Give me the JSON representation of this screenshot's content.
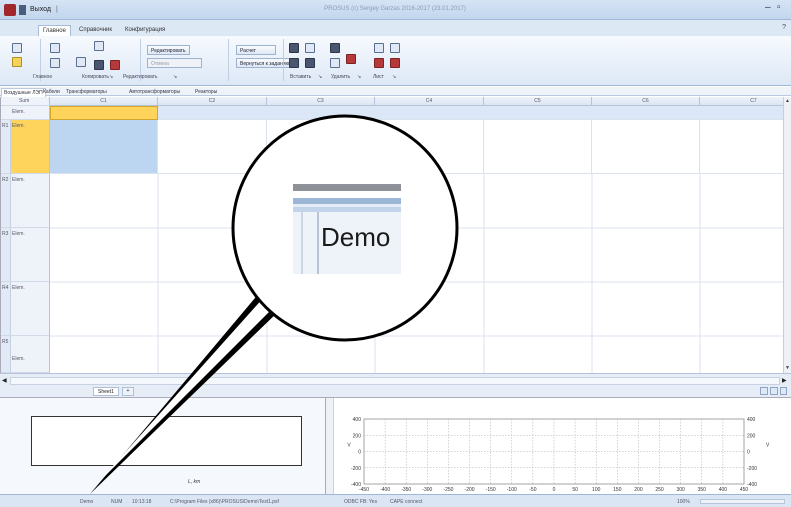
{
  "window": {
    "quick_access_label": "Выход",
    "quick_access_sep": "|",
    "title": "PROSUS (c) Sergey Garzas 2016-2017 (23.01.2017)",
    "minimize": "–",
    "restore": "▫",
    "help": "?"
  },
  "ribbon": {
    "tabs": [
      "Главное",
      "Справочник",
      "Конфигурация"
    ],
    "groups": [
      "Главное",
      "Копировать",
      "Редактировать",
      "Вставить",
      "Удалить",
      "Лист"
    ],
    "group_launcher": "↘",
    "buttons": {
      "edit": "Редактировать",
      "cancel": "Отмена",
      "calc": "Расчет",
      "return_to_task": "Вернуться к заданию"
    }
  },
  "doc_tabs": [
    "Воздушные ЛЭП",
    "Кабели",
    "Трансформаторы",
    "Автотрансформаторы",
    "Реакторы"
  ],
  "grid": {
    "corner_top": "Sum",
    "corner_elem": "Elem.",
    "columns": [
      "C1",
      "C2",
      "C3",
      "C4",
      "C5",
      "C6",
      "C7"
    ],
    "rows": [
      {
        "num": "R1",
        "elem": "Elem."
      },
      {
        "num": "R2",
        "elem": "Elem."
      },
      {
        "num": "R3",
        "elem": "Elem."
      },
      {
        "num": "R4",
        "elem": "Elem."
      },
      {
        "num": "R5",
        "elem": "Elem."
      }
    ]
  },
  "sheet_tab": "Sheet1",
  "sheet_add": "+",
  "cross_section": {
    "x_label": "L, km"
  },
  "chart_data": {
    "type": "line",
    "title": "",
    "xlabel": "",
    "ylabel": "V",
    "x_ticks": [
      -450,
      -400,
      -350,
      -300,
      -250,
      -200,
      -150,
      -100,
      -50,
      0,
      50,
      100,
      150,
      200,
      250,
      300,
      350,
      400,
      450
    ],
    "y_ticks": [
      400,
      200,
      0,
      -200,
      -400
    ],
    "y_right_ticks": [
      400,
      200,
      0,
      -200,
      -400
    ],
    "right_label": "V",
    "xlim": [
      -450,
      450
    ],
    "ylim": [
      -400,
      400
    ],
    "grid": true,
    "series": []
  },
  "statusbar": {
    "caps": "Demo",
    "num": "NUM",
    "time": "10:13:18",
    "path": "C:\\Program Files (x86)\\PROSUS\\Demo\\Test1.psf",
    "odbc": "ODBC FB: Yes",
    "cape": "CAPE connect",
    "zoom": "100%"
  },
  "magnifier": {
    "text": "Demo"
  }
}
